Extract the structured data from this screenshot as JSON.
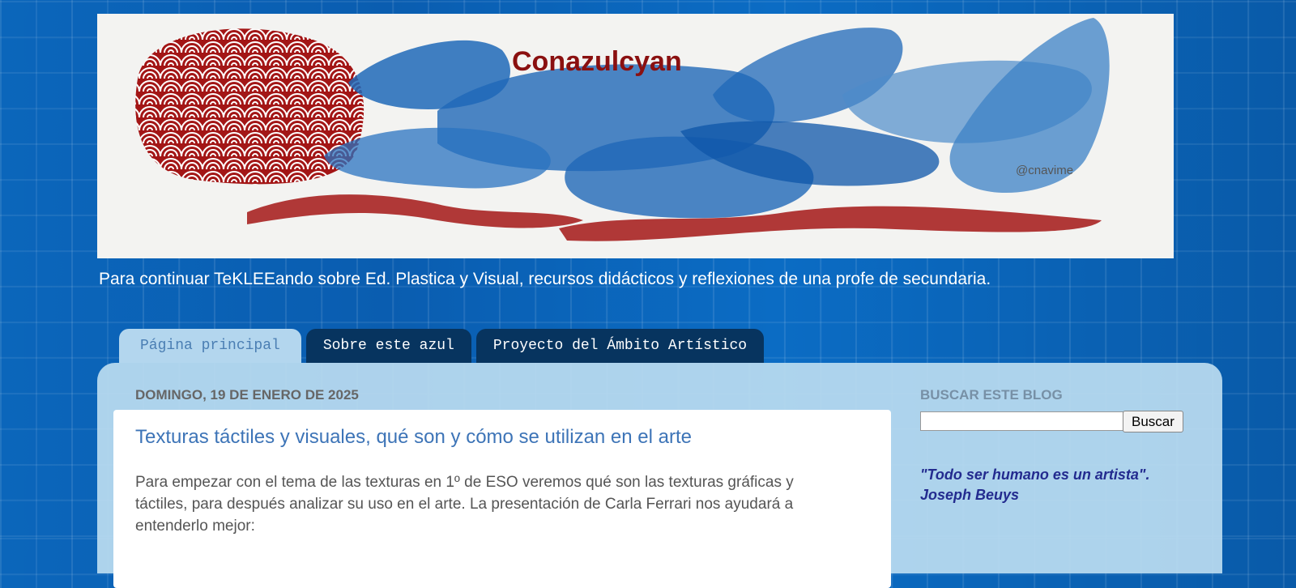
{
  "header": {
    "banner_title": "Conazulcyan",
    "banner_handle": "@cnavime",
    "tagline": "Para continuar TeKLEEando sobre Ed. Plastica y Visual, recursos didácticos y reflexiones de una profe de secundaria."
  },
  "tabs": [
    {
      "label": "Página principal",
      "active": true
    },
    {
      "label": "Sobre este azul",
      "active": false
    },
    {
      "label": "Proyecto del Ámbito Artístico",
      "active": false
    }
  ],
  "main": {
    "date": "DOMINGO, 19 DE ENERO DE 2025",
    "post": {
      "title": "Texturas táctiles y visuales, qué son y cómo se utilizan en el arte",
      "body": " Para empezar con el tema de las texturas en 1º de ESO veremos qué son las texturas gráficas y táctiles, para después analizar su uso en el arte. La presentación de Carla Ferrari nos ayudará a entenderlo mejor:"
    }
  },
  "sidebar": {
    "search_title": "BUSCAR ESTE BLOG",
    "search_value": "",
    "search_button": "Buscar",
    "quote": "\"Todo ser humano es un artista\". Joseph Beuys"
  },
  "colors": {
    "background": "#0a5fb0",
    "banner_red": "#a31616",
    "banner_blue": "#1f68b8",
    "active_tab": "#b3d6ee",
    "inactive_tab": "#07345f",
    "post_title": "#3d74b7",
    "quote": "#232b8f"
  }
}
